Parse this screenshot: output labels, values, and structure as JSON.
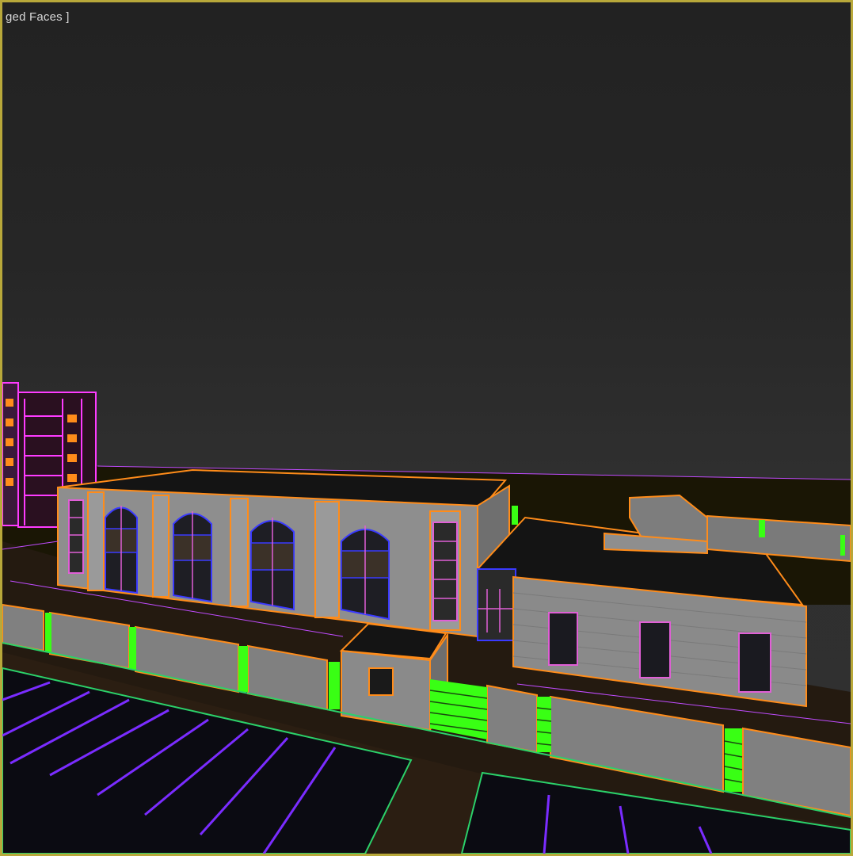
{
  "viewport": {
    "label": "ged Faces ]",
    "active_border_color": "#b8a83a",
    "background_color": "#2a2a2a"
  },
  "scene": {
    "wire_colors": {
      "main_building": "#ff8c1a",
      "windows": "#e05fd6",
      "window_glass_edges": "#3a3aff",
      "distant_tower": "#ff3bff",
      "hedge_gates": "#39ff14",
      "parking_lines": "#7a2cff",
      "ground_outline": "#2bd16a",
      "horizon_line": "#c04cff"
    },
    "objects": [
      "distant-tower",
      "main-building",
      "arched-windows",
      "side-annex",
      "gatehouse",
      "perimeter-wall",
      "green-gates",
      "parking-lot"
    ]
  }
}
